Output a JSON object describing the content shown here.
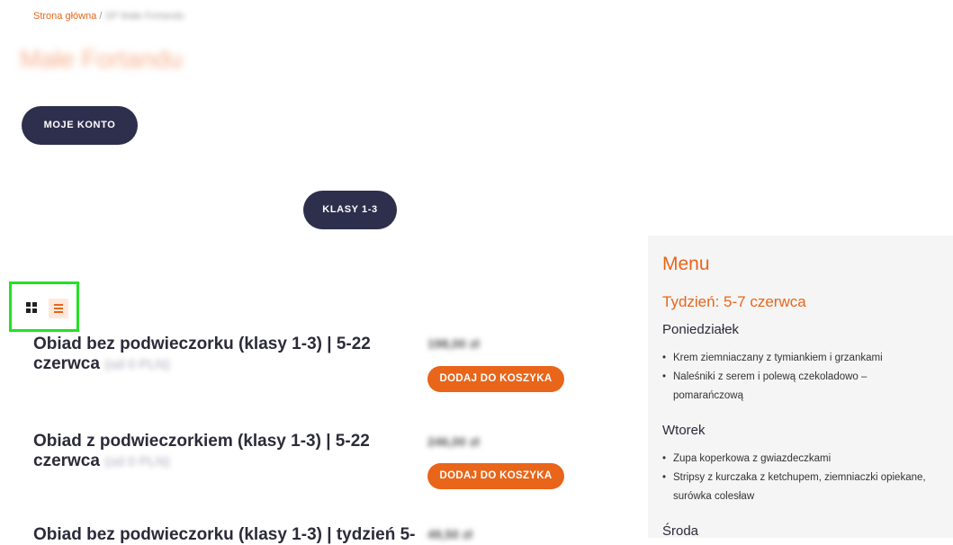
{
  "breadcrumb": {
    "home": "Strona główna",
    "separator": " / ",
    "current": "SP Małe Fortandu"
  },
  "page_title": "Małe Fortandu",
  "account_button": "MOJE KONTO",
  "grade_button": "KLASY 1-3",
  "products": [
    {
      "name": "Obiad bez podwieczorku (klasy 1-3) | 5-22 czerwca",
      "sub": "(od 0 PLN)",
      "price": "198,00 zł",
      "cart": "DODAJ DO KOSZYKA"
    },
    {
      "name": "Obiad z podwieczorkiem (klasy 1-3) | 5-22 czerwca",
      "sub": "(od 0 PLN)",
      "price": "246,00 zł",
      "cart": "DODAJ DO KOSZYKA"
    },
    {
      "name": "Obiad bez podwieczorku (klasy 1-3) | tydzień 5-",
      "price": "49,50 zł"
    }
  ],
  "sidebar": {
    "title": "Menu",
    "week": "Tydzień: 5-7 czerwca",
    "days": [
      {
        "name": "Poniedziałek",
        "items": [
          "Krem ziemniaczany z tymiankiem i grzankami",
          "Naleśniki z serem i polewą czekoladowo – pomarańczową"
        ]
      },
      {
        "name": "Wtorek",
        "items": [
          "Zupa koperkowa z gwiazdeczkami",
          "Stripsy z kurczaka z ketchupem, ziemniaczki opiekane, surówka colesław"
        ]
      },
      {
        "name": "Środa",
        "items": []
      }
    ]
  }
}
